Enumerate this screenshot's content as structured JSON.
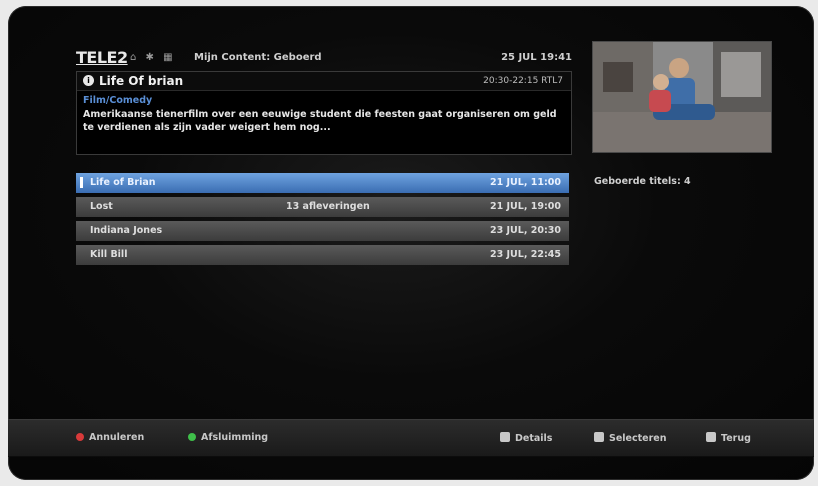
{
  "header": {
    "logo": "TELE2",
    "breadcrumb_icons": "⌂ ✱ ▦",
    "breadcrumb": "Mijn Content: Geboerd",
    "clock": "25 JUL 19:41"
  },
  "info": {
    "title": "Life Of brian",
    "time": "20:30-22:15  RTL7",
    "genre": "Film/Comedy",
    "description": "Amerikaanse tienerfilm over een eeuwige student die feesten gaat organiseren om geld te verdienen als zijn vader weigert hem nog..."
  },
  "recordings": [
    {
      "title": "Life of Brian",
      "note": "",
      "date": "21 JUL, 11:00",
      "selected": true
    },
    {
      "title": "Lost",
      "note": "13 afleveringen",
      "date": "21 JUL, 19:00",
      "selected": false
    },
    {
      "title": "Indiana Jones",
      "note": "",
      "date": "23 JUL, 20:30",
      "selected": false
    },
    {
      "title": "Kill Bill",
      "note": "",
      "date": "23 JUL, 22:45",
      "selected": false
    }
  ],
  "count_label": "Geboerde titels: 4",
  "footer": {
    "cancel": "Annuleren",
    "playback": "Afsluimming",
    "details": "Details",
    "select": "Selecteren",
    "back": "Terug"
  },
  "colors": {
    "selected_row": "#4a7fc6",
    "red_button": "#d83a3a",
    "green_button": "#3fbf4a"
  }
}
